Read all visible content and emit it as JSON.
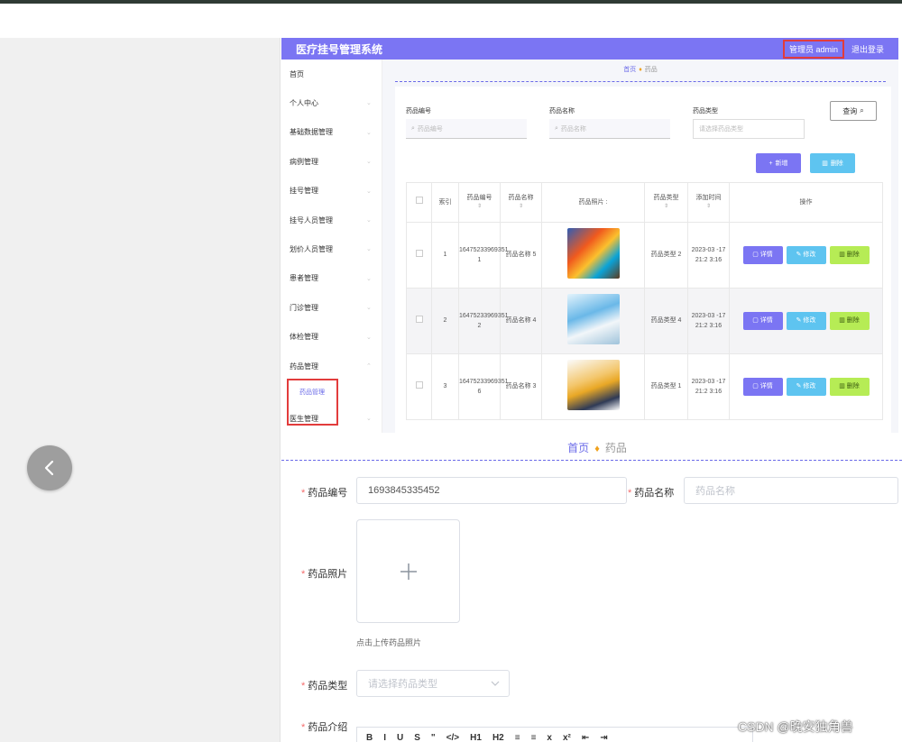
{
  "app": {
    "title": "医疗挂号管理系统",
    "admin_label": "管理员 admin",
    "logout_label": "退出登录"
  },
  "sidebar": {
    "items": [
      {
        "label": "首页"
      },
      {
        "label": "个人中心"
      },
      {
        "label": "基础数据管理"
      },
      {
        "label": "病例管理"
      },
      {
        "label": "挂号管理"
      },
      {
        "label": "挂号人员管理"
      },
      {
        "label": "划价人员管理"
      },
      {
        "label": "患者管理"
      },
      {
        "label": "门诊管理"
      },
      {
        "label": "体检管理"
      },
      {
        "label": "药品管理"
      },
      {
        "label": "医生管理"
      }
    ],
    "sub_item": "药品管理"
  },
  "breadcrumb": {
    "home": "首页",
    "current": "药品"
  },
  "filters": {
    "code_label": "药品编号",
    "code_placeholder": "药品编号",
    "name_label": "药品名称",
    "name_placeholder": "药品名称",
    "type_label": "药品类型",
    "type_placeholder": "请选择药品类型",
    "query_button": "查询"
  },
  "actions": {
    "add": "新增",
    "delete": "删除"
  },
  "table": {
    "headers": [
      "索引",
      "药品编号",
      "药品名称",
      "药品照片",
      "药品类型",
      "添加时间",
      "操作"
    ],
    "rows": [
      {
        "index": "1",
        "code": "16475233969351 1",
        "name": "药品名称 5",
        "type": "药品类型 2",
        "time": "2023-03 -17 21:2 3:16"
      },
      {
        "index": "2",
        "code": "16475233969351 2",
        "name": "药品名称 4",
        "type": "药品类型 4",
        "time": "2023-03 -17 21:2 3:16"
      },
      {
        "index": "3",
        "code": "16475233969351 6",
        "name": "药品名称 3",
        "type": "药品类型 1",
        "time": "2023-03 -17 21:2 3:16"
      }
    ],
    "btn_detail": "详情",
    "btn_edit": "修改",
    "btn_delete": "删除"
  },
  "form": {
    "crumb_home": "首页",
    "crumb_current": "药品",
    "code_label": "药品编号",
    "code_value": "1693845335452",
    "name_label": "药品名称",
    "name_placeholder": "药品名称",
    "photo_label": "药品照片",
    "upload_hint": "点击上传药品照片",
    "type_label": "药品类型",
    "type_placeholder": "请选择药品类型",
    "intro_label": "药品介绍",
    "toolbar": [
      "B",
      "I",
      "U",
      "S",
      "\"",
      "</>",
      "H1",
      "H2",
      "≡",
      "≡",
      "x",
      "x²",
      "⇤",
      "⇥"
    ]
  },
  "watermark": "CSDN @晚安独角兽",
  "colors": {
    "accent": "#7b75f3",
    "info": "#5ec4f0",
    "success": "#b6ec55",
    "highlight": "#e23c3c"
  }
}
